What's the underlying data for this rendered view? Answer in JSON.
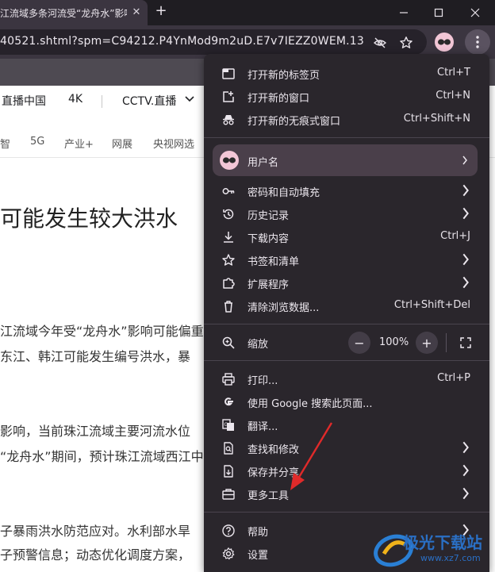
{
  "tab": {
    "title": "江流域多条河流受“龙舟水”影响",
    "close_glyph": "✕",
    "newtab_glyph": "+"
  },
  "window": {
    "minimize": "—",
    "maximize": "☐",
    "close": "✕"
  },
  "omnibox": {
    "url": "40521.shtml?spm=C94212.P4YnMod9m2uD.E7v7IEZZ0WEM.13"
  },
  "page": {
    "nav1": [
      "直播中国",
      "4K",
      "CCTV.直播"
    ],
    "nav2": [
      "智",
      "5G",
      "产业+",
      "网展",
      "央视网选"
    ],
    "headline": "可能发生较大洪水",
    "paragraphs": [
      "江流域今年受“龙舟水”影响可能偏重",
      "东江、韩江可能发生编号洪水，暴",
      "影响，当前珠江流域主要河流水位",
      "“龙舟水”期间，预计珠江流域西江中",
      "子暴雨洪水防范应对。水利部水旱",
      "子预警信息；动态优化调度方案，"
    ]
  },
  "menu": {
    "items_top": [
      {
        "icon": "new-tab-icon",
        "label": "打开新的标签页",
        "shortcut": "Ctrl+T"
      },
      {
        "icon": "new-window-icon",
        "label": "打开新的窗口",
        "shortcut": "Ctrl+N"
      },
      {
        "icon": "incognito-icon",
        "label": "打开新的无痕式窗口",
        "shortcut": "Ctrl+Shift+N"
      }
    ],
    "profile": {
      "label": "用户名"
    },
    "items_mid": [
      {
        "icon": "key-icon",
        "label": "密码和自动填充",
        "shortcut": ""
      },
      {
        "icon": "history-icon",
        "label": "历史记录",
        "shortcut": ""
      },
      {
        "icon": "download-icon",
        "label": "下载内容",
        "shortcut": "Ctrl+J"
      },
      {
        "icon": "bookmark-star-icon",
        "label": "书签和清单",
        "shortcut": ""
      },
      {
        "icon": "extension-icon",
        "label": "扩展程序",
        "shortcut": ""
      },
      {
        "icon": "trash-icon",
        "label": "清除浏览数据...",
        "shortcut": "Ctrl+Shift+Del"
      }
    ],
    "zoom": {
      "label": "缩放",
      "minus": "−",
      "value": "100%",
      "plus": "+"
    },
    "items_bottom": [
      {
        "icon": "print-icon",
        "label": "打印...",
        "shortcut": "Ctrl+P"
      },
      {
        "icon": "google-icon",
        "label": "使用 Google 搜索此页面...",
        "shortcut": ""
      },
      {
        "icon": "translate-icon",
        "label": "翻译...",
        "shortcut": ""
      },
      {
        "icon": "find-icon",
        "label": "查找和修改",
        "shortcut": ""
      },
      {
        "icon": "save-share-icon",
        "label": "保存并分享",
        "shortcut": ""
      },
      {
        "icon": "toolbox-icon",
        "label": "更多工具",
        "shortcut": ""
      }
    ],
    "items_last": [
      {
        "icon": "help-icon",
        "label": "帮助",
        "shortcut": ""
      },
      {
        "icon": "settings-gear-icon",
        "label": "设置",
        "shortcut": ""
      }
    ]
  },
  "watermark": {
    "text": "极光下载站",
    "url": "www.xz7.com"
  },
  "colors": {
    "menu_bg": "#2a262c",
    "toolbar_bg": "#3b3540",
    "arrow_red": "#e02a2a"
  }
}
